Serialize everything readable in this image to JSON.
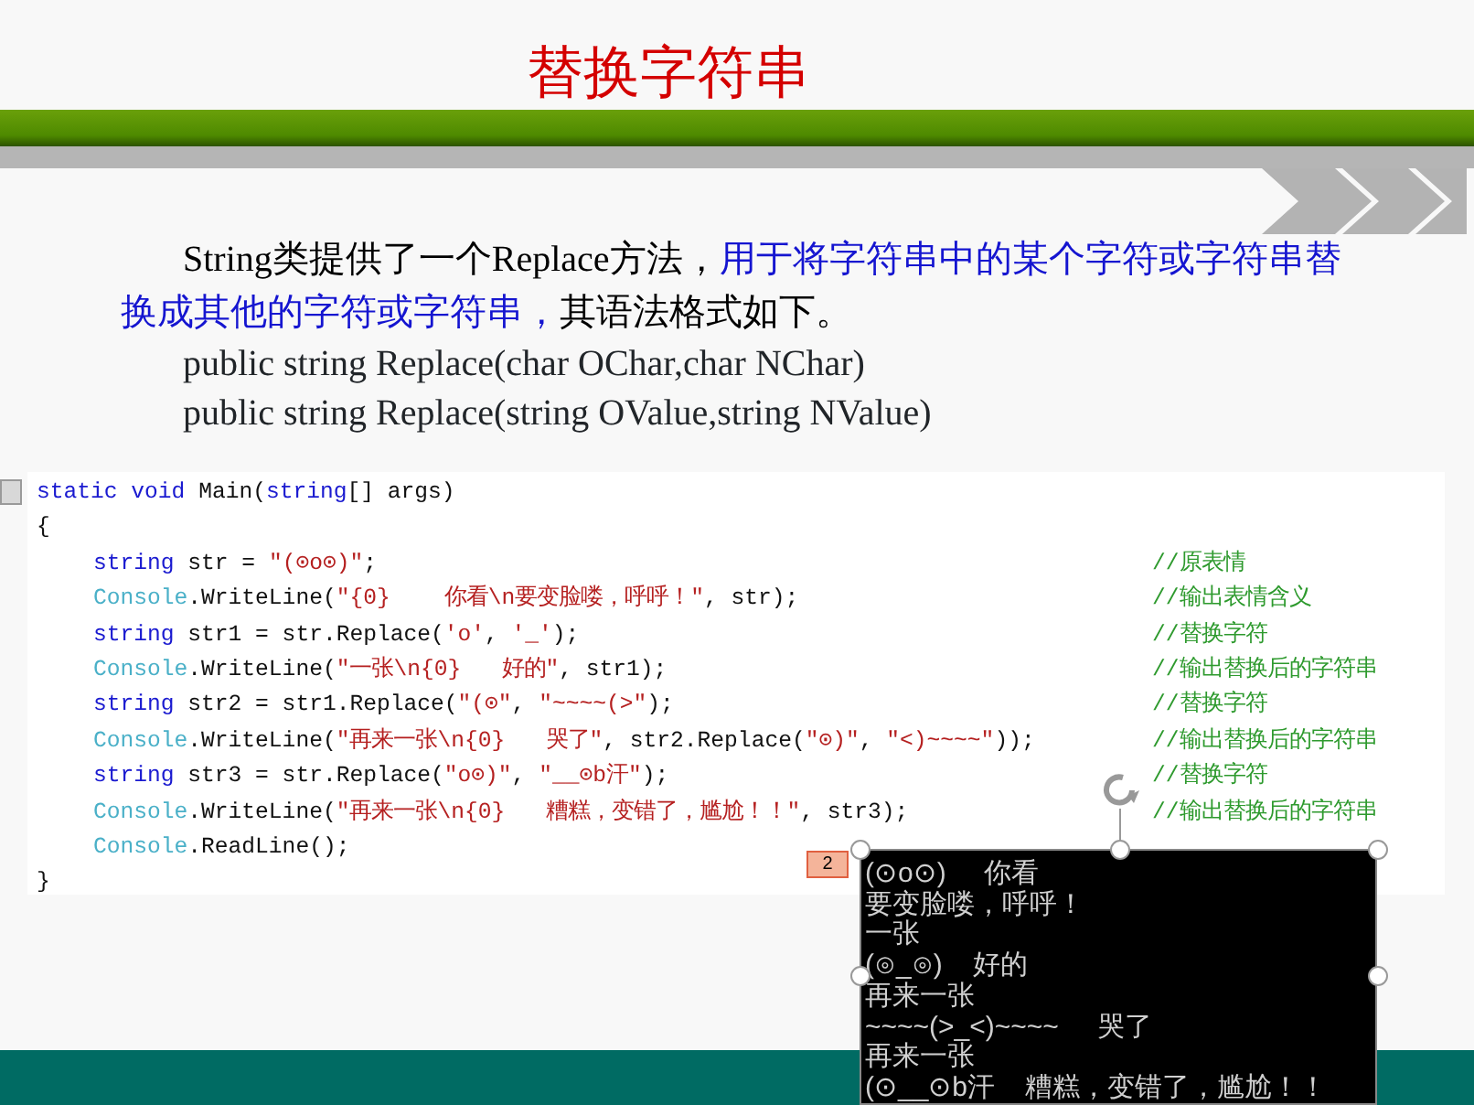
{
  "title": "替换字符串",
  "paragraph": [
    {
      "text": "String类提供了一个Replace方法，",
      "emphasis": false
    },
    {
      "text": "用于将字符串中的某个字符或字符串替换成其他的字符或字符串，",
      "emphasis": true
    },
    {
      "text": "其语法格式如下。",
      "emphasis": false
    }
  ],
  "syntax": [
    "public string Replace(char OChar,char NChar)",
    "public string Replace(string OValue,string NValue)"
  ],
  "code": {
    "signature": [
      {
        "kind": "keyword",
        "text": "static void "
      },
      {
        "kind": "plain",
        "text": "Main("
      },
      {
        "kind": "keyword",
        "text": "string"
      },
      {
        "kind": "plain",
        "text": "[] args)"
      }
    ],
    "open": "{",
    "body": [
      {
        "segments": [
          {
            "kind": "keyword",
            "text": "string "
          },
          {
            "kind": "plain",
            "text": "str = "
          },
          {
            "kind": "string",
            "text": "\"(⊙o⊙)\""
          },
          {
            "kind": "plain",
            "text": ";"
          }
        ],
        "comment": "//原表情"
      },
      {
        "segments": [
          {
            "kind": "type",
            "text": "Console"
          },
          {
            "kind": "plain",
            "text": ".WriteLine("
          },
          {
            "kind": "string",
            "text": "\"{0}    你看\\n要变脸喽，呼呼！\""
          },
          {
            "kind": "plain",
            "text": ", str);"
          }
        ],
        "comment": "//输出表情含义"
      },
      {
        "segments": [
          {
            "kind": "keyword",
            "text": "string "
          },
          {
            "kind": "plain",
            "text": "str1 = str.Replace("
          },
          {
            "kind": "string",
            "text": "'o'"
          },
          {
            "kind": "plain",
            "text": ", "
          },
          {
            "kind": "string",
            "text": "'_'"
          },
          {
            "kind": "plain",
            "text": ");"
          }
        ],
        "comment": "//替换字符"
      },
      {
        "segments": [
          {
            "kind": "type",
            "text": "Console"
          },
          {
            "kind": "plain",
            "text": ".WriteLine("
          },
          {
            "kind": "string",
            "text": "\"一张\\n{0}   好的\""
          },
          {
            "kind": "plain",
            "text": ", str1);"
          }
        ],
        "comment": "//输出替换后的字符串"
      },
      {
        "segments": [
          {
            "kind": "keyword",
            "text": "string "
          },
          {
            "kind": "plain",
            "text": "str2 = str1.Replace("
          },
          {
            "kind": "string",
            "text": "\"(⊙\""
          },
          {
            "kind": "plain",
            "text": ", "
          },
          {
            "kind": "string",
            "text": "\"~~~~(>\""
          },
          {
            "kind": "plain",
            "text": ");"
          }
        ],
        "comment": "//替换字符"
      },
      {
        "segments": [
          {
            "kind": "type",
            "text": "Console"
          },
          {
            "kind": "plain",
            "text": ".WriteLine("
          },
          {
            "kind": "string",
            "text": "\"再来一张\\n{0}   哭了\""
          },
          {
            "kind": "plain",
            "text": ", str2.Replace("
          },
          {
            "kind": "string",
            "text": "\"⊙)\""
          },
          {
            "kind": "plain",
            "text": ", "
          },
          {
            "kind": "string",
            "text": "\"<)~~~~\""
          },
          {
            "kind": "plain",
            "text": "));"
          }
        ],
        "comment": "//输出替换后的字符串"
      },
      {
        "segments": [
          {
            "kind": "keyword",
            "text": "string "
          },
          {
            "kind": "plain",
            "text": "str3 = str.Replace("
          },
          {
            "kind": "string",
            "text": "\"o⊙)\""
          },
          {
            "kind": "plain",
            "text": ", "
          },
          {
            "kind": "string",
            "text": "\"__⊙b汗\""
          },
          {
            "kind": "plain",
            "text": ");"
          }
        ],
        "comment": "//替换字符"
      },
      {
        "segments": [
          {
            "kind": "type",
            "text": "Console"
          },
          {
            "kind": "plain",
            "text": ".WriteLine("
          },
          {
            "kind": "string",
            "text": "\"再来一张\\n{0}   糟糕，变错了，尴尬！！\""
          },
          {
            "kind": "plain",
            "text": ", str3);"
          }
        ],
        "comment": "//输出替换后的字符串"
      },
      {
        "segments": [
          {
            "kind": "type",
            "text": "Console"
          },
          {
            "kind": "plain",
            "text": ".ReadLine();"
          }
        ]
      }
    ],
    "close": "}"
  },
  "badge": "2",
  "console": [
    "(⊙o⊙)     你看",
    "要变脸喽，呼呼！",
    "一张",
    "(⊙_⊙)    好的",
    "再来一张",
    "~~~~(>_<)~~~~     哭了",
    "再来一张",
    "(⊙__⊙b汗    糟糕，变错了，尴尬！！"
  ]
}
